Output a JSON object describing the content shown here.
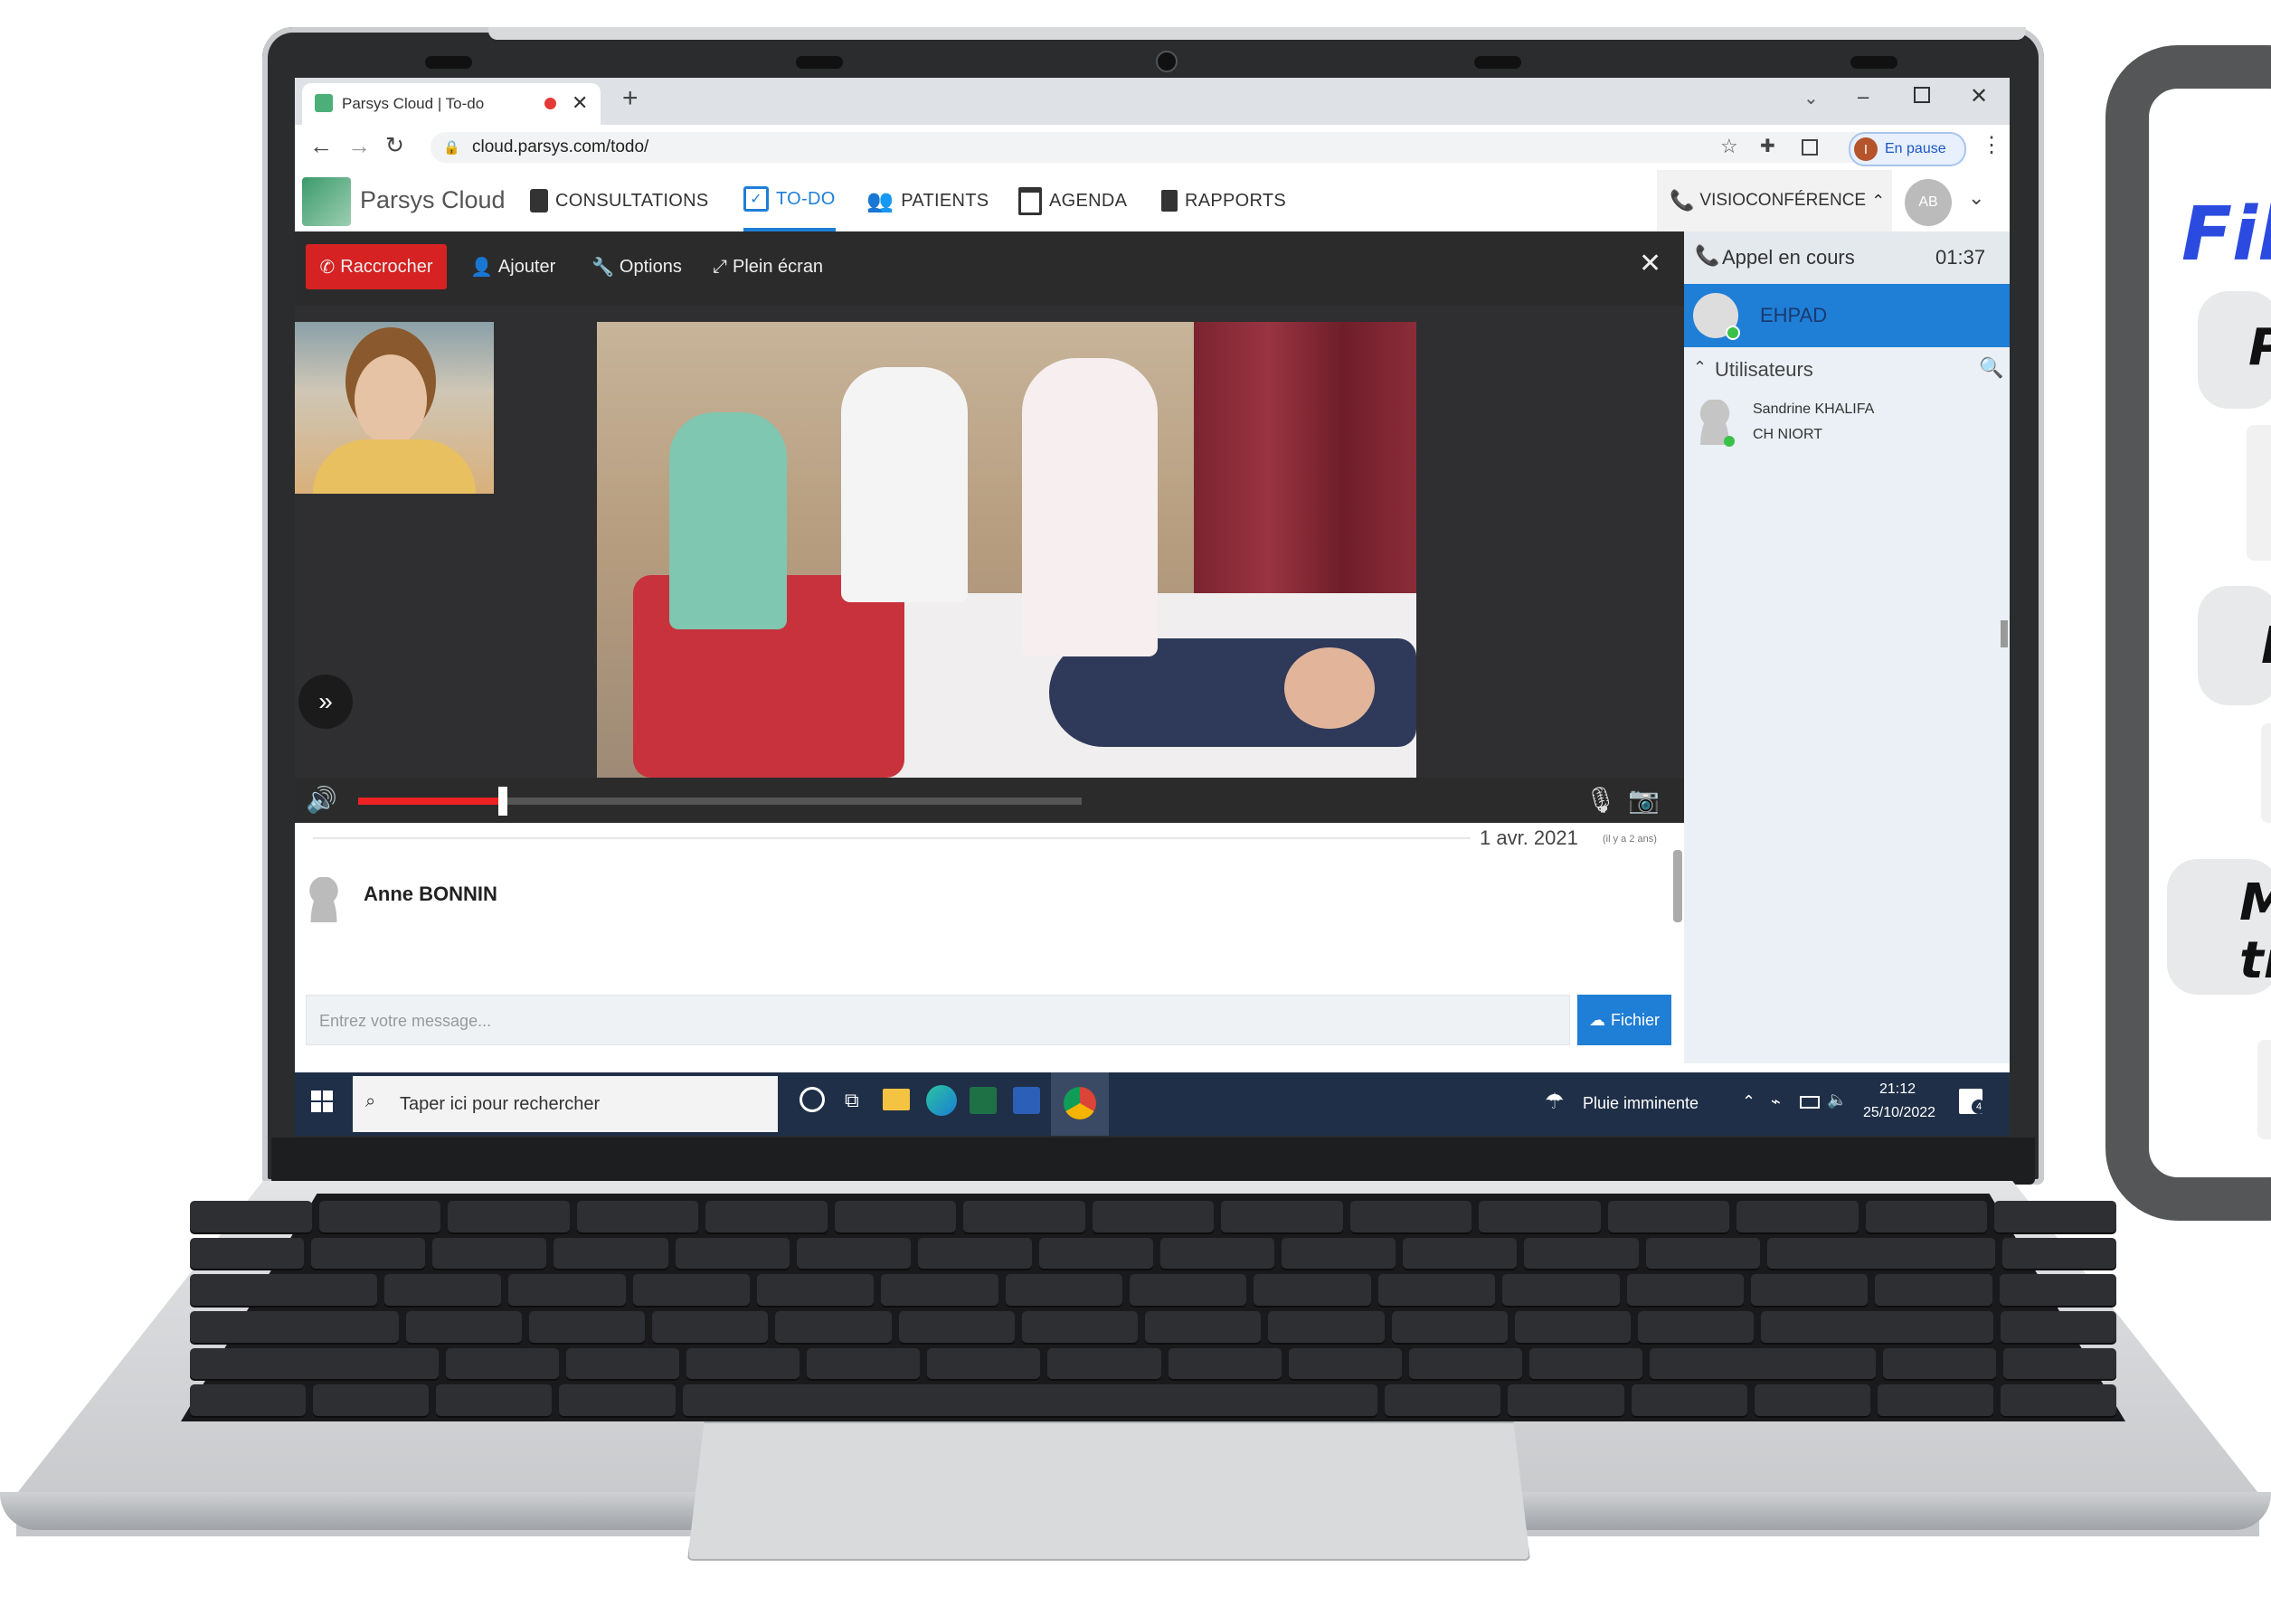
{
  "browser": {
    "tab_title": "Parsys Cloud | To-do",
    "url": "cloud.parsys.com/todo/",
    "profile_status": "En pause",
    "profile_initial": "I"
  },
  "app": {
    "brand": "Parsys Cloud",
    "nav": [
      {
        "label": "CONSULTATIONS",
        "icon": "clipboard-icon"
      },
      {
        "label": "TO-DO",
        "icon": "checklist-icon",
        "active": true
      },
      {
        "label": "PATIENTS",
        "icon": "people-icon"
      },
      {
        "label": "AGENDA",
        "icon": "calendar-icon"
      },
      {
        "label": "RAPPORTS",
        "icon": "document-icon"
      }
    ],
    "visio_label": "VISIOCONFÉRENCE",
    "avatar_initials": "AB"
  },
  "call_toolbar": {
    "hangup": "Raccrocher",
    "add": "Ajouter",
    "options": "Options",
    "fullscreen": "Plein écran"
  },
  "call_panel": {
    "title": "Appel en cours",
    "timer": "01:37",
    "active_participant": "EHPAD",
    "users_section": "Utilisateurs",
    "user_name": "Sandrine KHALIFA",
    "user_org": "CH NIORT"
  },
  "player": {
    "volume_level": 0.2
  },
  "chat": {
    "date": "1 avr. 2021",
    "date_relative": "(il y a 2 ans)",
    "author": "Anne BONNIN",
    "placeholder": "Entrez votre message...",
    "file_button": "Fichier"
  },
  "taskbar": {
    "search_placeholder": "Taper ici pour rechercher",
    "weather": "Pluie imminente",
    "time": "21:12",
    "date": "25/10/2022",
    "notifications": "4"
  },
  "side_card": {
    "title_fragment": "Fil",
    "texts": [
      "P",
      "E",
      "M",
      "tr"
    ]
  },
  "colors": {
    "accent_blue": "#1f7ed6",
    "hangup_red": "#d62222",
    "card_title_blue": "#2b4be0"
  }
}
